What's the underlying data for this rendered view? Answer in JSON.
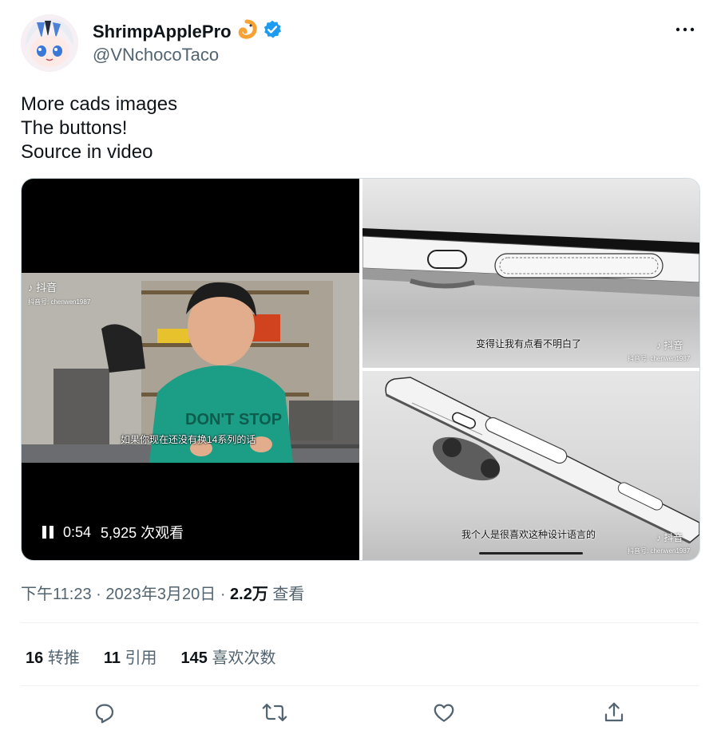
{
  "author": {
    "display_name": "ShrimpApplePro",
    "handle": "@VNchocoTaco"
  },
  "tweet_text": [
    "More cads images",
    "The buttons!",
    "Source in video"
  ],
  "media": {
    "video": {
      "subtitle": "如果你现在还没有换14系列的话",
      "tiktok_brand": "抖音",
      "tiktok_id": "抖音号: chenwen1987",
      "time": "0:54",
      "views": "5,925 次观看"
    },
    "image_top": {
      "subtitle": "变得让我有点看不明白了",
      "tiktok_brand": "抖音",
      "tiktok_id": "抖音号: chenwen1987"
    },
    "image_bottom": {
      "subtitle": "我个人是很喜欢这种设计语言的",
      "tiktok_brand": "抖音",
      "tiktok_id": "抖音号: chenwen1987"
    }
  },
  "meta": {
    "time": "下午11:23",
    "sep1": "·",
    "date": "2023年3月20日",
    "sep2": "·",
    "views_count": "2.2万",
    "views_label": "查看"
  },
  "stats": {
    "retweets_count": "16",
    "retweets_label": "转推",
    "quotes_count": "11",
    "quotes_label": "引用",
    "likes_count": "145",
    "likes_label": "喜欢次数"
  },
  "icons": {
    "verified": "verified-badge-icon",
    "emoji": "shrimp-emoji-icon",
    "more": "more-dots-icon",
    "reply": "reply-icon",
    "retweet": "retweet-icon",
    "like": "heart-icon",
    "share": "share-icon"
  },
  "colors": {
    "verified": "#1d9bf0",
    "shrimp": "#f7a234",
    "muted": "#536471",
    "text": "#0f1419"
  }
}
